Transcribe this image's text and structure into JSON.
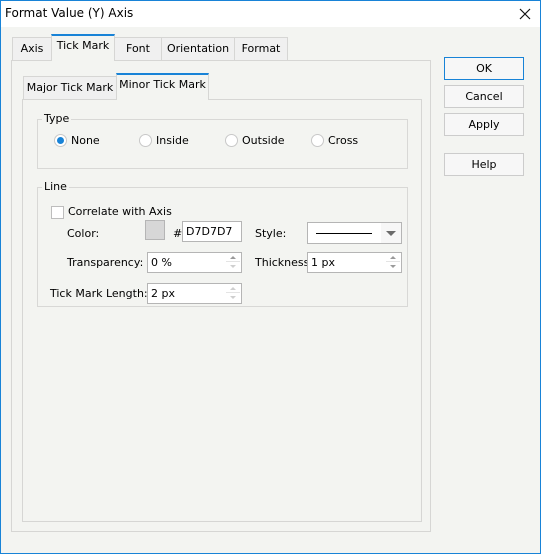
{
  "window": {
    "title": "Format Value (Y) Axis",
    "close_icon": "close-icon"
  },
  "tabs": [
    {
      "label": "Axis",
      "active": false
    },
    {
      "label": "Tick Mark",
      "active": true
    },
    {
      "label": "Font",
      "active": false
    },
    {
      "label": "Orientation",
      "active": false
    },
    {
      "label": "Format",
      "active": false
    }
  ],
  "subtabs": [
    {
      "label": "Major Tick Mark",
      "active": false
    },
    {
      "label": "Minor Tick Mark",
      "active": true
    }
  ],
  "type_group": {
    "label": "Type",
    "options": [
      {
        "label": "None",
        "checked": true
      },
      {
        "label": "Inside",
        "checked": false
      },
      {
        "label": "Outside",
        "checked": false
      },
      {
        "label": "Cross",
        "checked": false
      }
    ]
  },
  "line_group": {
    "label": "Line",
    "correlate_label": "Correlate with Axis",
    "correlate_checked": false,
    "color_label": "Color:",
    "color_hash": "#",
    "color_value": "D7D7D7",
    "color_swatch": "#d7d7d7",
    "style_label": "Style:",
    "style_value": "solid",
    "transparency_label": "Transparency:",
    "transparency_value": "0 %",
    "thickness_label": "Thickness:",
    "thickness_value": "1 px"
  },
  "tick_length": {
    "label": "Tick Mark Length:",
    "value": "2 px"
  },
  "buttons": {
    "ok": "OK",
    "cancel": "Cancel",
    "apply": "Apply",
    "help": "Help"
  },
  "colors": {
    "accent": "#1883d7",
    "background": "#f3f4f1"
  }
}
